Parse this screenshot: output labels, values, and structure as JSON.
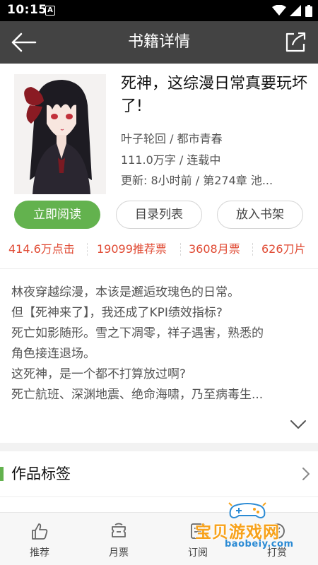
{
  "status_bar": {
    "time": "10:15",
    "notification_badge": "A"
  },
  "header": {
    "title": "书籍详情",
    "back_icon": "arrow-left-icon",
    "share_icon": "share-icon"
  },
  "book": {
    "title": "死神，这综漫日常真要玩坏了!",
    "author_genre": "叶子轮回 / 都市青春",
    "words_status": "111.0万字 / 连载中",
    "update": "更新: 8小时前 / 第274章 池..."
  },
  "buttons": {
    "read": "立即阅读",
    "toc": "目录列表",
    "shelf": "放入书架"
  },
  "stats": [
    "414.6万点击",
    "19099推荐票",
    "3608月票",
    "626刀片"
  ],
  "description": [
    "林夜穿越综漫，本该是邂逅玫瑰色的日常。",
    "但【死神来了】，我还成了KPI绩效指标?",
    "死亡如影随形。雪之下凋零，祥子遇害，熟悉的",
    "角色接连退场。",
    "这死神，是一个都不打算放过啊?",
    "死亡航班、深渊地震、绝命海啸，乃至病毒生..."
  ],
  "tags_section": {
    "label": "作品标签"
  },
  "bottom_tabs": [
    {
      "label": "推荐",
      "icon": "thumbs-up-icon"
    },
    {
      "label": "月票",
      "icon": "ticket-icon"
    },
    {
      "label": "订阅",
      "icon": "subscribe-icon"
    },
    {
      "label": "打赏",
      "icon": "reward-icon"
    }
  ],
  "watermark": {
    "text": "宝贝游戏网",
    "sub": "baobeiy.com"
  },
  "colors": {
    "header_bg": "#434343",
    "accent_green": "#63b24e",
    "stat_red": "#e04a33"
  }
}
